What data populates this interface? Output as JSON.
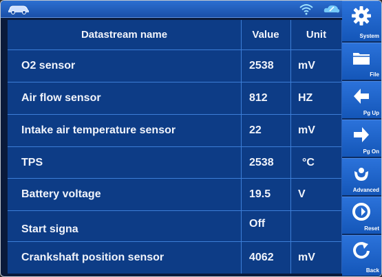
{
  "table": {
    "headers": {
      "name": "Datastream name",
      "value": "Value",
      "unit": "Unit"
    },
    "rows": [
      {
        "name": "O2 sensor",
        "value": "2538",
        "unit": "mV"
      },
      {
        "name": "Air flow sensor",
        "value": "812",
        "unit": "HZ"
      },
      {
        "name": "Intake air temperature sensor",
        "value": "22",
        "unit": "mV"
      },
      {
        "name": "TPS",
        "value": "2538",
        "unit": "°C"
      },
      {
        "name": "Battery voltage",
        "value": "19.5",
        "unit": "V"
      },
      {
        "name": "Start signa",
        "value": "Off",
        "unit": ""
      },
      {
        "name": "Crankshaft position sensor",
        "value": "4062",
        "unit": "mV"
      }
    ]
  },
  "sidebar": {
    "items": [
      {
        "label": "System",
        "icon": "gear-icon"
      },
      {
        "label": "File",
        "icon": "folder-icon"
      },
      {
        "label": "Pg Up",
        "icon": "arrow-left-icon"
      },
      {
        "label": "Pg On",
        "icon": "arrow-right-icon"
      },
      {
        "label": "Advanced",
        "icon": "advanced-icon"
      },
      {
        "label": "Reset",
        "icon": "reset-icon"
      },
      {
        "label": "Back",
        "icon": "back-icon"
      }
    ]
  },
  "colors": {
    "table_bg": "#0d3c86",
    "grid": "#3d7fd8",
    "sidebar_btn": "#1f63c7",
    "topbar": "#2c6fd1"
  }
}
